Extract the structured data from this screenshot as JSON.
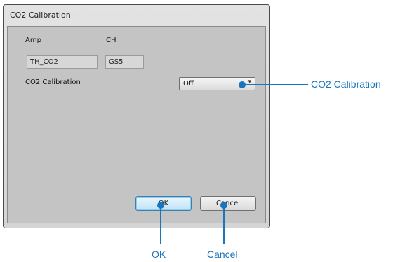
{
  "dialog": {
    "title": "CO2 Calibration",
    "amp_label": "Amp",
    "ch_label": "CH",
    "amp_value": "TH_CO2",
    "ch_value": "GS5",
    "calibration_label": "CO2 Calibration",
    "calibration_value": "Off",
    "dropdown_arrow": "▾",
    "ok_label": "OK",
    "cancel_label": "Cancel"
  },
  "callouts": {
    "calibration": "CO2 Calibration",
    "ok": "OK",
    "cancel": "Cancel",
    "color": "#1b75bc"
  }
}
